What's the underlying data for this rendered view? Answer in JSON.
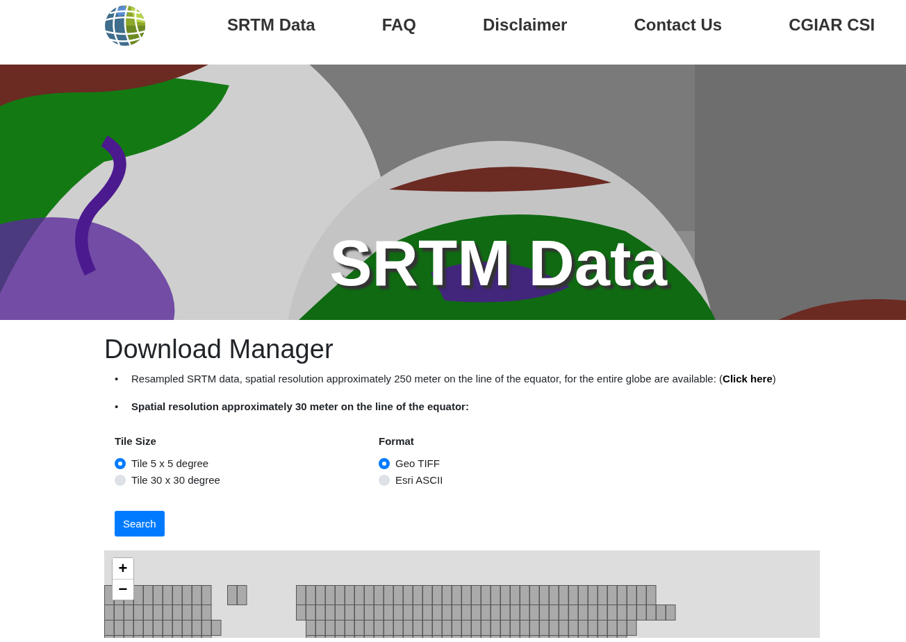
{
  "nav": {
    "items": [
      "SRTM Data",
      "FAQ",
      "Disclaimer",
      "Contact Us",
      "CGIAR CSI"
    ]
  },
  "hero": {
    "title": "SRTM Data"
  },
  "content": {
    "heading": "Download Manager",
    "bullets": [
      {
        "kind": "link",
        "marker": "•",
        "text": "Resampled SRTM data, spatial resolution approximately 250 meter on the line of the equator, for the entire globe are available: (",
        "link": "Click here",
        "after": ")"
      },
      {
        "kind": "bold",
        "marker": "•",
        "text": "Spatial resolution approximately 30 meter on the line of the equator:"
      }
    ]
  },
  "options": [
    {
      "label": "Tile Size",
      "choices": [
        {
          "label": "Tile 5 x 5 degree",
          "selected": true
        },
        {
          "label": "Tile 30 x 30 degree",
          "selected": false
        }
      ]
    },
    {
      "label": "Format",
      "choices": [
        {
          "label": "Geo TIFF",
          "selected": true
        },
        {
          "label": "Esri ASCII",
          "selected": false
        }
      ]
    }
  ],
  "search_button": "Search",
  "map": {
    "zoom_in": "+",
    "zoom_out": "−"
  }
}
